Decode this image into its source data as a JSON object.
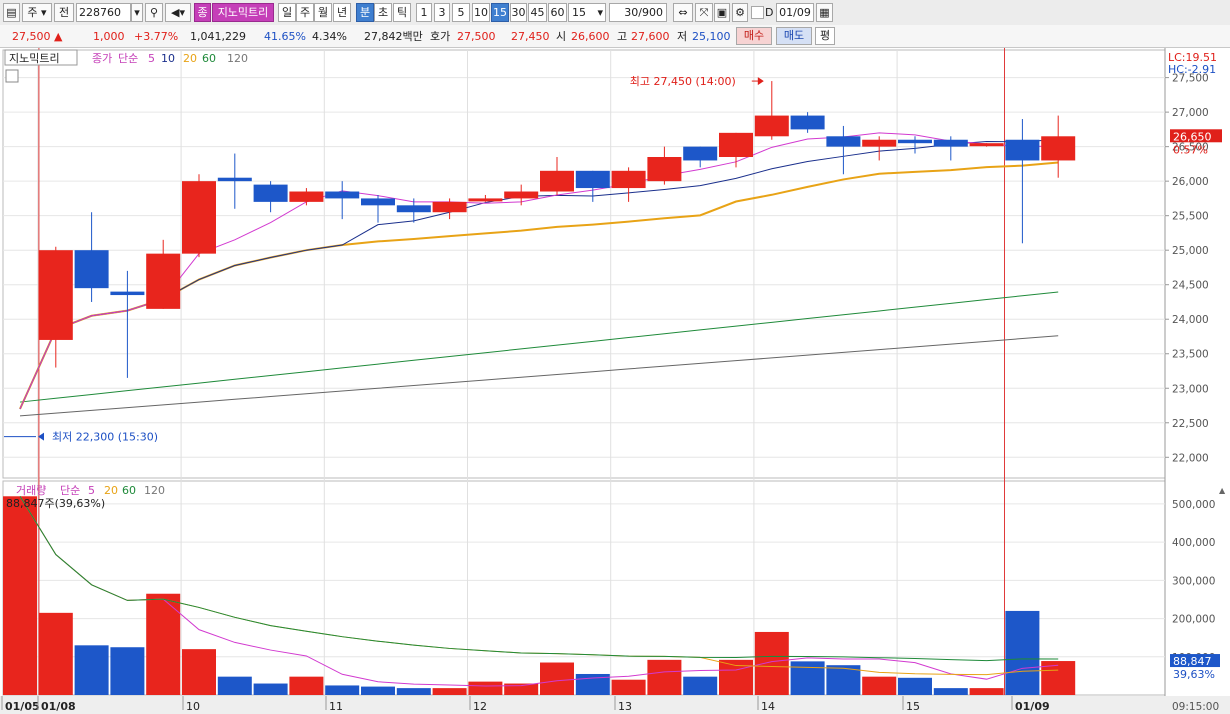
{
  "toolbar": {
    "mode_select": "주",
    "prev_label": "전",
    "code": "228760",
    "stock_badge": "종",
    "stock_name": "지노믹트리",
    "periods": [
      "일",
      "주",
      "월",
      "년",
      "분",
      "초",
      "틱"
    ],
    "active_period": "분",
    "intervals": [
      "1",
      "3",
      "5",
      "10",
      "15",
      "30",
      "45",
      "60"
    ],
    "active_interval": "15",
    "interval_value": "15",
    "count": "30/900",
    "date": "01/09"
  },
  "quote": {
    "price": "27,500",
    "change": "1,000",
    "change_rate": "+3.77%",
    "volume": "1,041,229",
    "vol_ratio": "41.65%",
    "turnover": "4.34%",
    "amount": "27,842백만",
    "ask_label": "호가",
    "ask": "27,500",
    "bid": "27,450",
    "open_label": "시",
    "open": "26,600",
    "high_label": "고",
    "high": "27,600",
    "low_label": "저",
    "low": "25,100",
    "buy_label": "매수",
    "sell_label": "매도",
    "avg_label": "평"
  },
  "colors": {
    "up": "#e8251d",
    "down": "#1d57c9",
    "ma5": "#d23ad0",
    "ma10": "#1a2f8c",
    "ma20": "#e8a316",
    "ma60": "#1f8a3a",
    "ma120": "#666666"
  },
  "chart_data": [
    {
      "type": "candlestick",
      "title_tab": "지노믹트리",
      "legend": [
        "종가",
        "단순",
        "5",
        "10",
        "20",
        "60",
        "120"
      ],
      "ylim": [
        21700,
        27900
      ],
      "y_ticks": [
        "27,500",
        "27,000",
        "26,500",
        "26,000",
        "25,500",
        "25,000",
        "24,500",
        "24,000",
        "23,500",
        "23,000",
        "22,500",
        "22,000"
      ],
      "current_price_label": "26,650",
      "current_rate_label": "0.57%",
      "lc_label": "LC:19.51",
      "hc_label": "HC:-2.91",
      "high_annotation": "최고 27,450 (14:00)",
      "low_annotation": "최저 22,300 (15:30)",
      "x_labels": [
        "01/05",
        "01/08",
        "10",
        "11",
        "12",
        "13",
        "14",
        "15",
        "01/09"
      ],
      "candles": [
        {
          "o": 23700,
          "h": 25050,
          "l": 23300,
          "c": 25000
        },
        {
          "o": 25000,
          "h": 25550,
          "l": 24250,
          "c": 24450
        },
        {
          "o": 24400,
          "h": 24700,
          "l": 23150,
          "c": 24350
        },
        {
          "o": 24150,
          "h": 25150,
          "l": 24150,
          "c": 24950
        },
        {
          "o": 24950,
          "h": 26100,
          "l": 24900,
          "c": 26000
        },
        {
          "o": 26050,
          "h": 26400,
          "l": 25600,
          "c": 26000
        },
        {
          "o": 25950,
          "h": 26000,
          "l": 25550,
          "c": 25700
        },
        {
          "o": 25700,
          "h": 25900,
          "l": 25650,
          "c": 25850
        },
        {
          "o": 25850,
          "h": 26000,
          "l": 25450,
          "c": 25750
        },
        {
          "o": 25750,
          "h": 25800,
          "l": 25400,
          "c": 25650
        },
        {
          "o": 25650,
          "h": 25750,
          "l": 25400,
          "c": 25550
        },
        {
          "o": 25550,
          "h": 25750,
          "l": 25450,
          "c": 25700
        },
        {
          "o": 25750,
          "h": 25800,
          "l": 25700,
          "c": 25750
        },
        {
          "o": 25750,
          "h": 25950,
          "l": 25650,
          "c": 25850
        },
        {
          "o": 25850,
          "h": 26350,
          "l": 25800,
          "c": 26150
        },
        {
          "o": 26150,
          "h": 26150,
          "l": 25700,
          "c": 25900
        },
        {
          "o": 25900,
          "h": 26200,
          "l": 25700,
          "c": 26150
        },
        {
          "o": 26000,
          "h": 26500,
          "l": 25950,
          "c": 26350
        },
        {
          "o": 26500,
          "h": 26500,
          "l": 26200,
          "c": 26300
        },
        {
          "o": 26350,
          "h": 26700,
          "l": 26200,
          "c": 26700
        },
        {
          "o": 26650,
          "h": 27450,
          "l": 26600,
          "c": 26950
        },
        {
          "o": 26950,
          "h": 27000,
          "l": 26700,
          "c": 26750
        },
        {
          "o": 26650,
          "h": 26800,
          "l": 26100,
          "c": 26500
        },
        {
          "o": 26500,
          "h": 26650,
          "l": 26300,
          "c": 26600
        },
        {
          "o": 26600,
          "h": 26650,
          "l": 26400,
          "c": 26550
        },
        {
          "o": 26600,
          "h": 26650,
          "l": 26300,
          "c": 26500
        },
        {
          "o": 26550,
          "h": 26550,
          "l": 26500,
          "c": 26550
        },
        {
          "o": 26600,
          "h": 26900,
          "l": 25100,
          "c": 26300
        },
        {
          "o": 26300,
          "h": 26950,
          "l": 26050,
          "c": 26650
        }
      ]
    },
    {
      "type": "bar",
      "legend": [
        "거래량",
        "단순",
        "5",
        "20",
        "60",
        "120"
      ],
      "current_label": "88,847주(39,63%)",
      "last_value_label": "88,847",
      "last_rate_label": "39,63%",
      "ylim": [
        0,
        560000
      ],
      "y_ticks": [
        "500,000",
        "400,000",
        "300,000",
        "200,000",
        "100,000"
      ],
      "values": [
        520000,
        215000,
        130000,
        125000,
        265000,
        120000,
        48000,
        30000,
        48000,
        25000,
        22000,
        18000,
        18000,
        35000,
        30000,
        85000,
        55000,
        40000,
        92000,
        48000,
        92000,
        165000,
        88000,
        78000,
        48000,
        45000,
        18000,
        18000,
        220000,
        88847
      ]
    }
  ],
  "time_label": "09:15:00"
}
